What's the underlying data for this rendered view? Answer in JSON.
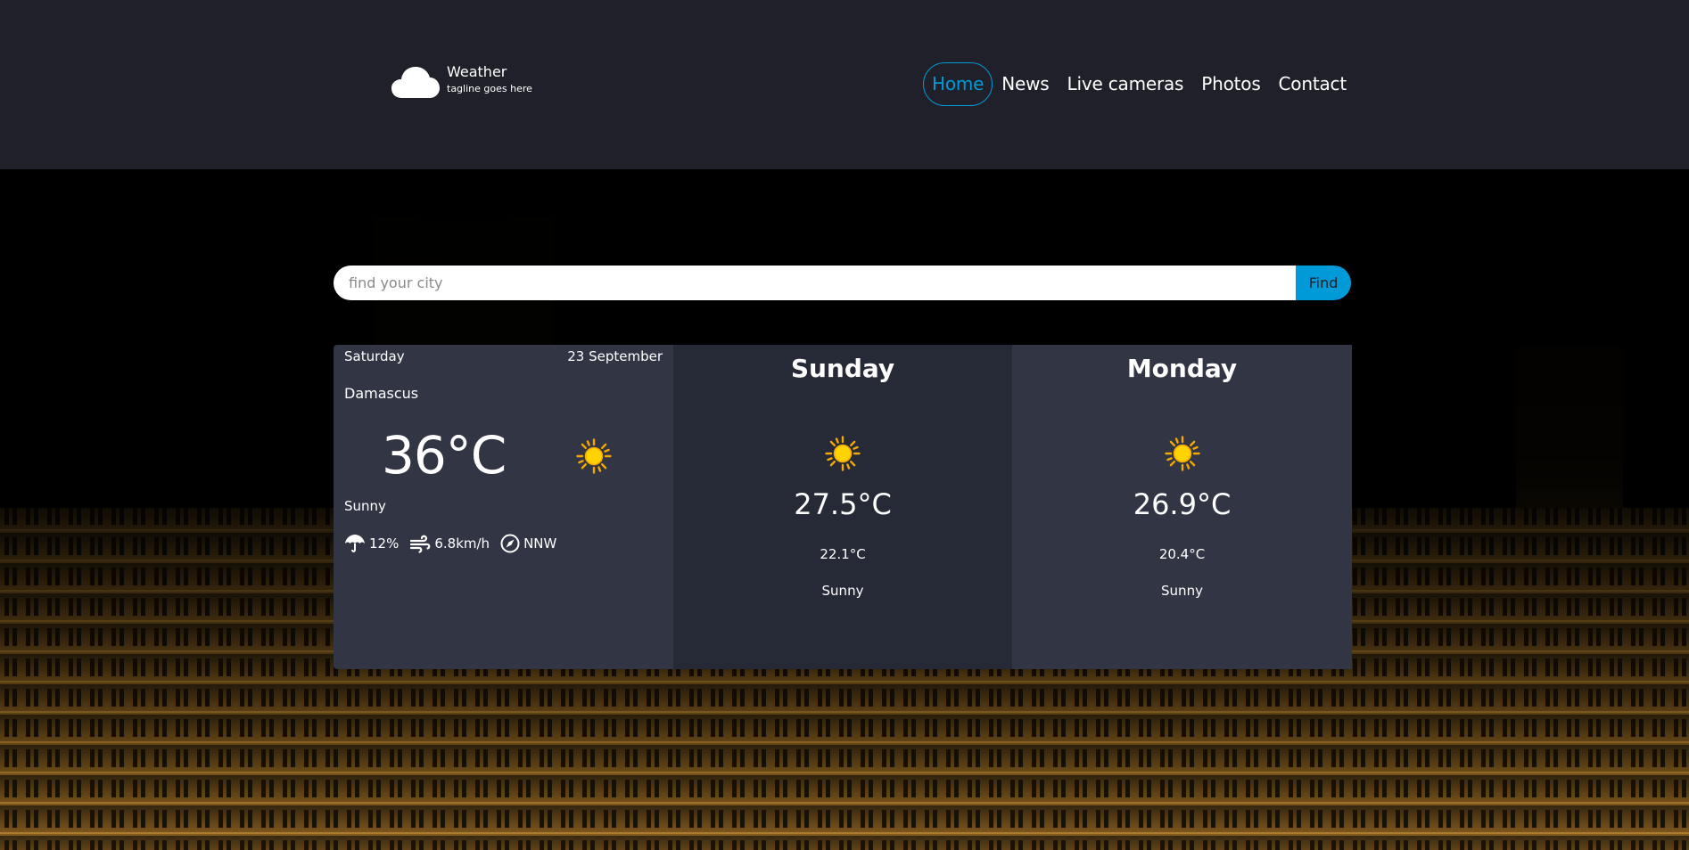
{
  "brand": {
    "title": "Weather",
    "tagline": "tagline goes here"
  },
  "nav": {
    "items": [
      {
        "label": "Home",
        "active": true
      },
      {
        "label": "News",
        "active": false
      },
      {
        "label": "Live cameras",
        "active": false
      },
      {
        "label": "Photos",
        "active": false
      },
      {
        "label": "Contact",
        "active": false
      }
    ]
  },
  "search": {
    "placeholder": "find your city",
    "value": "",
    "button_label": "Find"
  },
  "today": {
    "day": "Saturday",
    "date": "23 September",
    "city": "Damascus",
    "temperature": "36°C",
    "condition": "Sunny",
    "icon": "sun-icon",
    "rain_chance": "12%",
    "wind_speed": "6.8km/h",
    "wind_direction": "NNW"
  },
  "forecast": [
    {
      "day": "Sunday",
      "max": "27.5°C",
      "min": "22.1°C",
      "condition": "Sunny",
      "icon": "sun-icon"
    },
    {
      "day": "Monday",
      "max": "26.9°C",
      "min": "20.4°C",
      "condition": "Sunny",
      "icon": "sun-icon"
    }
  ],
  "colors": {
    "accent": "#009ad8",
    "header_bg": "#1f2029",
    "card_light": "#323544",
    "card_dark": "#262936",
    "sun": "#ffd200"
  }
}
